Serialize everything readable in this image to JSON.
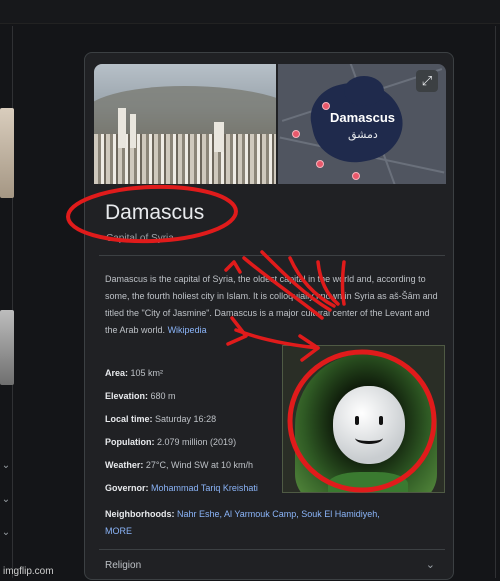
{
  "panel": {
    "map": {
      "label": "Damascus",
      "label_ar": "دمشق",
      "expand_icon": "expand-icon"
    },
    "title": "Damascus",
    "subtitle": "Capital of Syria",
    "description": {
      "text": "Damascus is the capital of Syria, the oldest capital in the world and, according to some, the fourth holiest city in Islam. It is colloquially known in Syria as aš-Šām and titled the \"City of Jasmine\". Damascus is a major cultural center of the Levant and the Arab world.",
      "source_link": "Wikipedia"
    },
    "facts": [
      {
        "label": "Area:",
        "value": "105 km²"
      },
      {
        "label": "Elevation:",
        "value": "680 m"
      },
      {
        "label": "Local time:",
        "value": "Saturday 16:28"
      },
      {
        "label": "Population:",
        "value": "2.079 million (2019)"
      },
      {
        "label": "Weather:",
        "value": "27°C, Wind SW at 10 km/h"
      },
      {
        "label": "Governor:",
        "value": "Mohammad Tariq Kreishati",
        "link": true
      },
      {
        "label": "Neighborhoods:",
        "value": "Nahr Eshe, Al Yarmouk Camp, Souk El Hamidiyeh,",
        "link": true,
        "more": "MORE"
      }
    ],
    "collapsed_section": "Religion"
  },
  "watermark": "imgflip.com",
  "colors": {
    "background": "#202124",
    "link": "#8ab4f8",
    "annotation_red": "#e01b1b"
  }
}
